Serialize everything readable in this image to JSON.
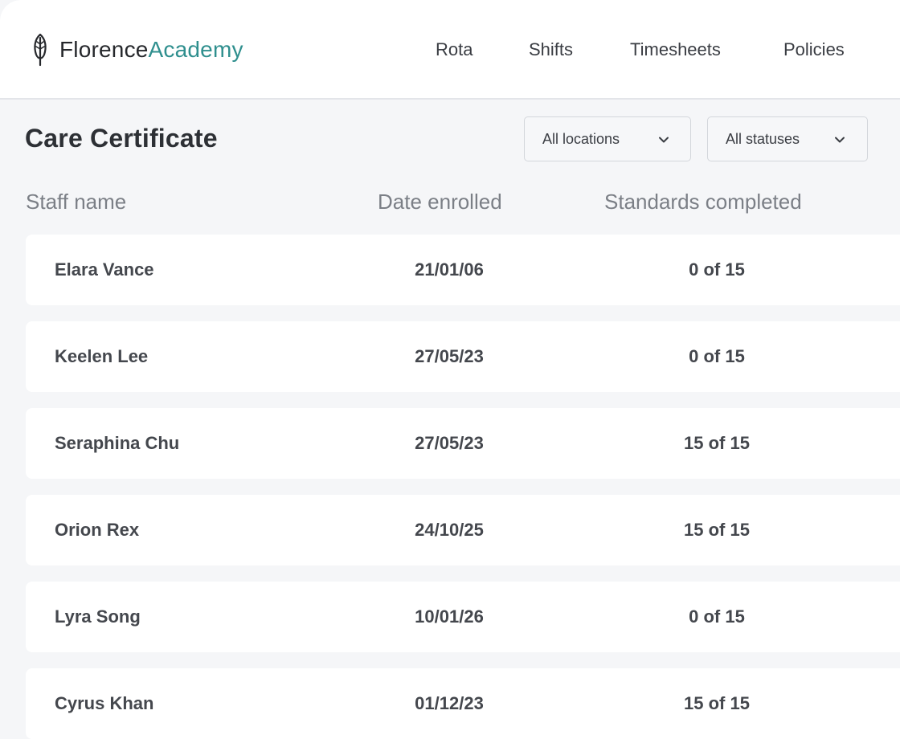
{
  "brand": {
    "name_part1": "Florence",
    "name_part2": "Academy",
    "accent_color": "#2f8f8e",
    "icon": "feather-icon"
  },
  "nav": {
    "items": [
      {
        "label": "Rota"
      },
      {
        "label": "Shifts"
      },
      {
        "label": "Timesheets"
      },
      {
        "label": "Policies"
      }
    ]
  },
  "page": {
    "title": "Care Certificate"
  },
  "filters": {
    "locations": {
      "selected": "All locations",
      "icon": "chevron-down-icon"
    },
    "statuses": {
      "selected": "All statuses",
      "icon": "chevron-down-icon"
    }
  },
  "table": {
    "columns": [
      "Staff name",
      "Date enrolled",
      "Standards completed"
    ],
    "rows": [
      {
        "name": "Elara Vance",
        "date_enrolled": "21/01/06",
        "standards_completed": "0 of 15"
      },
      {
        "name": "Keelen Lee",
        "date_enrolled": "27/05/23",
        "standards_completed": "0 of 15"
      },
      {
        "name": "Seraphina Chu",
        "date_enrolled": "27/05/23",
        "standards_completed": "15 of 15"
      },
      {
        "name": "Orion Rex",
        "date_enrolled": "24/10/25",
        "standards_completed": "15 of 15"
      },
      {
        "name": "Lyra Song",
        "date_enrolled": "10/01/26",
        "standards_completed": "0 of 15"
      },
      {
        "name": "Cyrus Khan",
        "date_enrolled": "01/12/23",
        "standards_completed": "15 of 15"
      }
    ]
  },
  "colors": {
    "background": "#f5f6f8",
    "header_bg": "#ffffff",
    "text_primary": "#2f3237",
    "text_muted": "#7b7f86"
  }
}
